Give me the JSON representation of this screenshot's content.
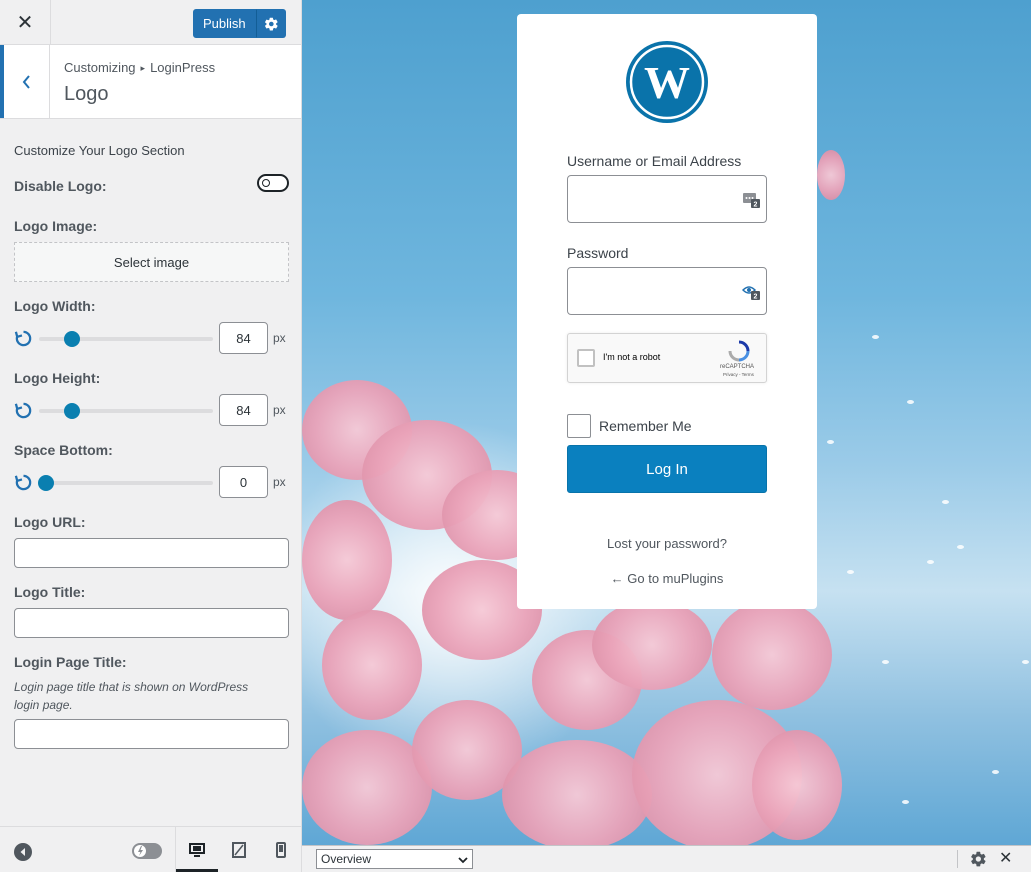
{
  "header": {
    "close_icon": "close-icon",
    "publish_label": "Publish",
    "publish_settings_icon": "gear-icon"
  },
  "section": {
    "breadcrumb_parent": "Customizing",
    "breadcrumb_child": "LoginPress",
    "title": "Logo"
  },
  "controls": {
    "description": "Customize Your Logo Section",
    "disable_logo_label": "Disable Logo:",
    "logo_image_label": "Logo Image:",
    "select_image_label": "Select image",
    "logo_width_label": "Logo Width:",
    "logo_width_value": "84",
    "logo_height_label": "Logo Height:",
    "logo_height_value": "84",
    "space_bottom_label": "Space Bottom:",
    "space_bottom_value": "0",
    "unit": "px",
    "logo_url_label": "Logo URL:",
    "logo_title_label": "Logo Title:",
    "login_page_title_label": "Login Page Title:",
    "login_page_title_help": "Login page title that is shown on WordPress login page."
  },
  "footer": {
    "devices": [
      "desktop-icon",
      "tablet-icon",
      "mobile-icon"
    ],
    "active_device": "desktop"
  },
  "login_form": {
    "username_label": "Username or Email Address",
    "password_label": "Password",
    "recaptcha_text": "I'm not a robot",
    "recaptcha_brand": "reCAPTCHA",
    "recaptcha_terms": "Privacy - Terms",
    "remember_label": "Remember Me",
    "login_button": "Log In",
    "lost_password": "Lost your password?",
    "back_link": "← Go to muPlugins"
  },
  "bottom_bar": {
    "select_value": "Overview"
  },
  "colors": {
    "accent": "#2271b1",
    "login_button": "#0a80bf",
    "slider_thumb": "#0a7fb0"
  }
}
